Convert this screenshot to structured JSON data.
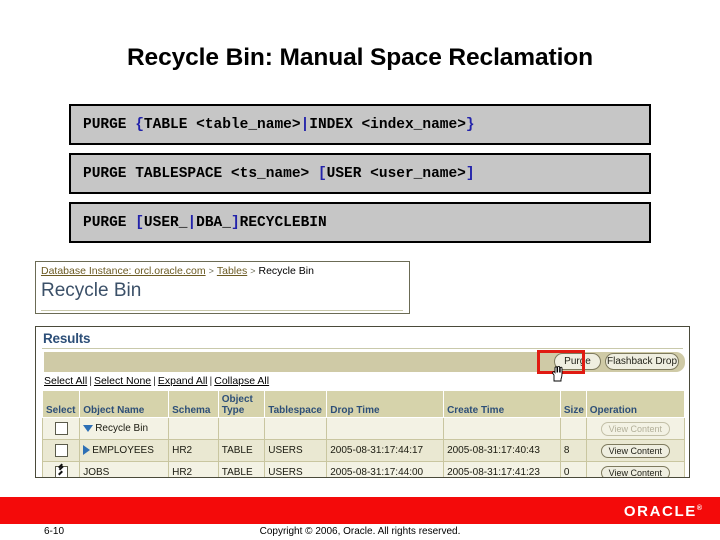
{
  "slide": {
    "title": "Recycle Bin: Manual Space Reclamation",
    "page_number": "6-10",
    "copyright": "Copyright © 2006, Oracle. All rights reserved.",
    "brand": "ORACLE",
    "brand_tm": "®",
    "accent_color": "#f40a0a",
    "highlight_color": "#e01b12"
  },
  "syntax_boxes": [
    {
      "id": "purge-object",
      "parts": [
        {
          "text": "PURGE ",
          "kind": "keyword"
        },
        {
          "text": "{",
          "kind": "punct"
        },
        {
          "text": "TABLE <table_name>",
          "kind": "keyword"
        },
        {
          "text": "|",
          "kind": "punct"
        },
        {
          "text": "INDEX <index_name>",
          "kind": "keyword"
        },
        {
          "text": "}",
          "kind": "punct"
        }
      ],
      "plain": "PURGE {TABLE <table_name>|INDEX <index_name>}"
    },
    {
      "id": "purge-tablespace",
      "parts": [
        {
          "text": "PURGE TABLESPACE <ts_name> ",
          "kind": "keyword"
        },
        {
          "text": "[",
          "kind": "punct"
        },
        {
          "text": "USER <user_name>",
          "kind": "keyword"
        },
        {
          "text": "]",
          "kind": "punct"
        }
      ],
      "plain": "PURGE TABLESPACE <ts_name> [USER <user_name>]"
    },
    {
      "id": "purge-recyclebin",
      "parts": [
        {
          "text": "PURGE ",
          "kind": "keyword"
        },
        {
          "text": "[",
          "kind": "punct"
        },
        {
          "text": "USER_",
          "kind": "keyword"
        },
        {
          "text": "|",
          "kind": "punct"
        },
        {
          "text": "DBA_",
          "kind": "keyword"
        },
        {
          "text": "]",
          "kind": "punct"
        },
        {
          "text": "RECYCLEBIN",
          "kind": "keyword"
        }
      ],
      "plain": "PURGE [USER_|DBA_]RECYCLEBIN"
    }
  ],
  "breadcrumb": {
    "items": [
      {
        "label": "Database Instance: orcl.oracle.com",
        "link": true
      },
      {
        "label": "Tables",
        "link": true
      },
      {
        "label": "Recycle Bin",
        "link": false
      }
    ],
    "separator": ">",
    "heading": "Recycle Bin"
  },
  "results": {
    "title": "Results",
    "buttons": {
      "purge": "Purge",
      "flashback_drop": "Flashback Drop"
    },
    "links": {
      "select_all": "Select All",
      "select_none": "Select None",
      "expand_all": "Expand All",
      "collapse_all": "Collapse All",
      "separator": "|"
    },
    "columns": [
      "Select",
      "Object Name",
      "Schema",
      "Object Type",
      "Tablespace",
      "Drop Time",
      "Create Time",
      "Size",
      "Operation"
    ],
    "operation_label": "View Content",
    "rows": [
      {
        "checked": false,
        "toggle": "down",
        "indent": 1,
        "object_name": "Recycle Bin",
        "schema": "",
        "object_type": "",
        "tablespace": "",
        "drop_time": "",
        "create_time": "",
        "size": "",
        "operation": "View Content",
        "operation_disabled": true
      },
      {
        "checked": false,
        "toggle": "right",
        "indent": 2,
        "object_name": "EMPLOYEES",
        "schema": "HR2",
        "object_type": "TABLE",
        "tablespace": "USERS",
        "drop_time": "2005-08-31:17:44:17",
        "create_time": "2005-08-31:17:40:43",
        "size": "8",
        "operation": "View Content",
        "operation_disabled": false
      },
      {
        "checked": true,
        "toggle": "none",
        "indent": 2,
        "object_name": "JOBS",
        "schema": "HR2",
        "object_type": "TABLE",
        "tablespace": "USERS",
        "drop_time": "2005-08-31:17:44:00",
        "create_time": "2005-08-31:17:41:23",
        "size": "0",
        "operation": "View Content",
        "operation_disabled": false
      }
    ]
  }
}
